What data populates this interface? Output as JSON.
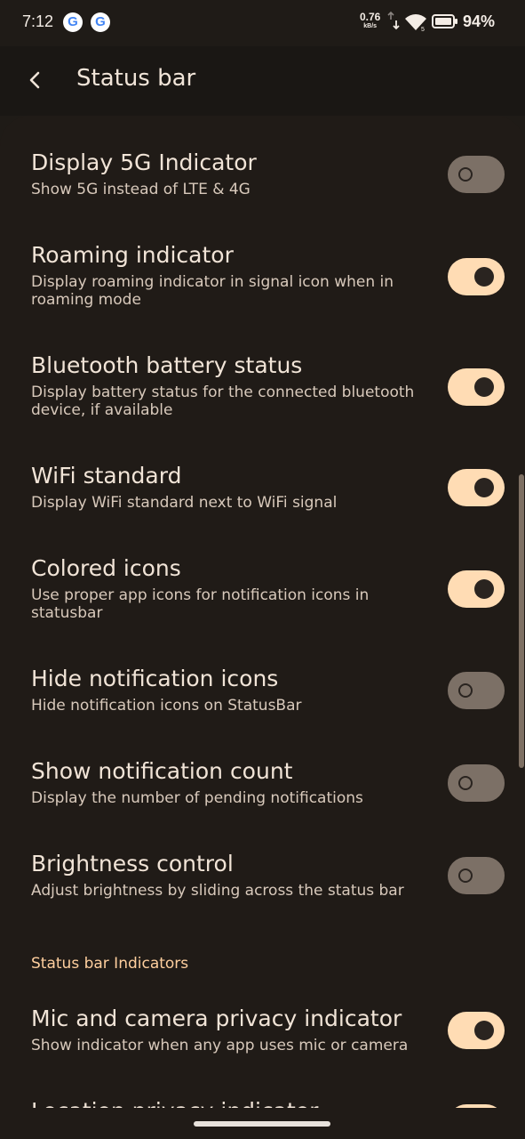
{
  "status_bar": {
    "time": "7:12",
    "notification_icons": [
      "G",
      "G"
    ],
    "net_speed_value": "0.76",
    "net_speed_unit": "kB/s",
    "battery_percent": "94%"
  },
  "header": {
    "title": "Status bar"
  },
  "settings": [
    {
      "title": "Display 5G Indicator",
      "summary": "Show 5G instead of LTE & 4G",
      "enabled": false
    },
    {
      "title": "Roaming indicator",
      "summary": "Display roaming indicator in signal icon when in roaming mode",
      "enabled": true
    },
    {
      "title": "Bluetooth battery status",
      "summary": "Display battery status for the connected bluetooth device, if available",
      "enabled": true
    },
    {
      "title": "WiFi standard",
      "summary": "Display WiFi standard next to WiFi signal",
      "enabled": true
    },
    {
      "title": "Colored icons",
      "summary": "Use proper app icons for notification icons in statusbar",
      "enabled": true
    },
    {
      "title": "Hide notification icons",
      "summary": "Hide notification icons on StatusBar",
      "enabled": false
    },
    {
      "title": "Show notification count",
      "summary": "Display the number of pending notifications",
      "enabled": false
    },
    {
      "title": "Brightness control",
      "summary": "Adjust brightness by sliding across the status bar",
      "enabled": false
    }
  ],
  "section_indicators": {
    "header": "Status bar Indicators",
    "items": [
      {
        "title": "Mic and camera privacy indicator",
        "summary": "Show indicator when any app uses mic or camera",
        "enabled": true
      },
      {
        "title": "Location privacy indicator",
        "summary": "",
        "enabled": true
      }
    ]
  }
}
